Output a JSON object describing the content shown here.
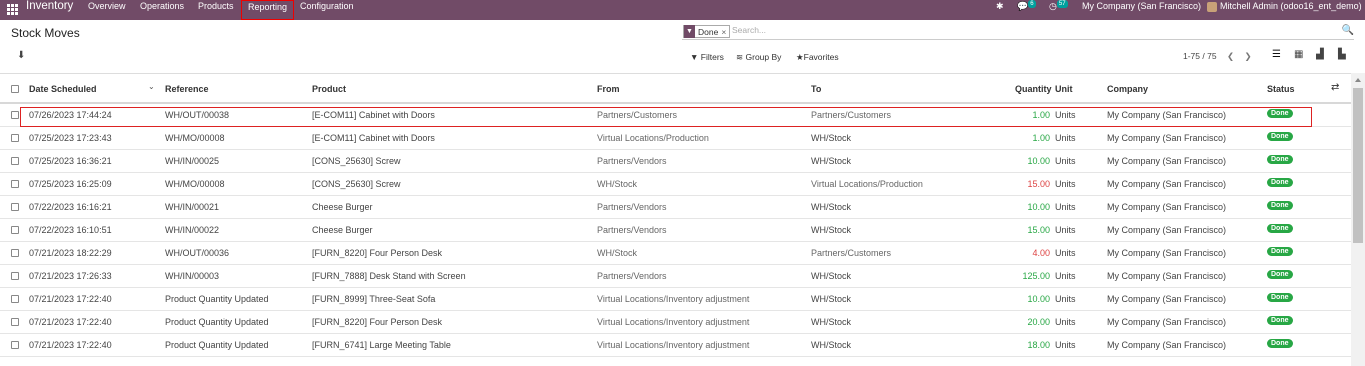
{
  "topbar": {
    "app_name": "Inventory",
    "menu": [
      "Overview",
      "Operations",
      "Products",
      "Reporting",
      "Configuration"
    ],
    "chat_count": "6",
    "activity_count": "57",
    "company": "My Company (San Francisco)",
    "user": "Mitchell Admin (odoo16_ent_demo)"
  },
  "page": {
    "title": "Stock Moves"
  },
  "search": {
    "facet_label": "Done",
    "facet_close": "×",
    "placeholder": "Search..."
  },
  "controls": {
    "filters": "Filters",
    "group_by": "Group By",
    "favorites": "Favorites"
  },
  "pager": {
    "text": "1-75 / 75"
  },
  "table": {
    "headers": [
      "Date Scheduled",
      "Reference",
      "Product",
      "From",
      "To",
      "Quantity",
      "Unit",
      "Company",
      "Status"
    ],
    "rows": [
      {
        "date": "07/26/2023 17:44:24",
        "ref": "WH/OUT/00038",
        "product": "[E-COM11] Cabinet with Doors",
        "from": "Partners/Customers",
        "to": "Partners/Customers",
        "qty": "1.00",
        "qty_color": "green",
        "unit": "Units",
        "company": "My Company (San Francisco)",
        "status": "Done"
      },
      {
        "date": "07/25/2023 17:23:43",
        "ref": "WH/MO/00008",
        "product": "[E-COM11] Cabinet with Doors",
        "from": "Virtual Locations/Production",
        "to": "WH/Stock",
        "qty": "1.00",
        "qty_color": "green",
        "unit": "Units",
        "company": "My Company (San Francisco)",
        "status": "Done"
      },
      {
        "date": "07/25/2023 16:36:21",
        "ref": "WH/IN/00025",
        "product": "[CONS_25630] Screw",
        "from": "Partners/Vendors",
        "to": "WH/Stock",
        "qty": "10.00",
        "qty_color": "green",
        "unit": "Units",
        "company": "My Company (San Francisco)",
        "status": "Done"
      },
      {
        "date": "07/25/2023 16:25:09",
        "ref": "WH/MO/00008",
        "product": "[CONS_25630] Screw",
        "from": "WH/Stock",
        "to": "Virtual Locations/Production",
        "qty": "15.00",
        "qty_color": "red",
        "unit": "Units",
        "company": "My Company (San Francisco)",
        "status": "Done"
      },
      {
        "date": "07/22/2023 16:16:21",
        "ref": "WH/IN/00021",
        "product": "Cheese Burger",
        "from": "Partners/Vendors",
        "to": "WH/Stock",
        "qty": "10.00",
        "qty_color": "green",
        "unit": "Units",
        "company": "My Company (San Francisco)",
        "status": "Done"
      },
      {
        "date": "07/22/2023 16:10:51",
        "ref": "WH/IN/00022",
        "product": "Cheese Burger",
        "from": "Partners/Vendors",
        "to": "WH/Stock",
        "qty": "15.00",
        "qty_color": "green",
        "unit": "Units",
        "company": "My Company (San Francisco)",
        "status": "Done"
      },
      {
        "date": "07/21/2023 18:22:29",
        "ref": "WH/OUT/00036",
        "product": "[FURN_8220] Four Person Desk",
        "from": "WH/Stock",
        "to": "Partners/Customers",
        "qty": "4.00",
        "qty_color": "red",
        "unit": "Units",
        "company": "My Company (San Francisco)",
        "status": "Done"
      },
      {
        "date": "07/21/2023 17:26:33",
        "ref": "WH/IN/00003",
        "product": "[FURN_7888] Desk Stand with Screen",
        "from": "Partners/Vendors",
        "to": "WH/Stock",
        "qty": "125.00",
        "qty_color": "green",
        "unit": "Units",
        "company": "My Company (San Francisco)",
        "status": "Done"
      },
      {
        "date": "07/21/2023 17:22:40",
        "ref": "Product Quantity Updated",
        "product": "[FURN_8999] Three-Seat Sofa",
        "from": "Virtual Locations/Inventory adjustment",
        "to": "WH/Stock",
        "qty": "10.00",
        "qty_color": "green",
        "unit": "Units",
        "company": "My Company (San Francisco)",
        "status": "Done"
      },
      {
        "date": "07/21/2023 17:22:40",
        "ref": "Product Quantity Updated",
        "product": "[FURN_8220] Four Person Desk",
        "from": "Virtual Locations/Inventory adjustment",
        "to": "WH/Stock",
        "qty": "20.00",
        "qty_color": "green",
        "unit": "Units",
        "company": "My Company (San Francisco)",
        "status": "Done"
      },
      {
        "date": "07/21/2023 17:22:40",
        "ref": "Product Quantity Updated",
        "product": "[FURN_6741] Large Meeting Table",
        "from": "Virtual Locations/Inventory adjustment",
        "to": "WH/Stock",
        "qty": "18.00",
        "qty_color": "green",
        "unit": "Units",
        "company": "My Company (San Francisco)",
        "status": "Done"
      }
    ]
  },
  "colors": {
    "brand": "#714B67",
    "done_badge": "#28a745",
    "qty_negative": "#dd4444",
    "qty_positive": "#28a745",
    "highlight": "#dd2222"
  }
}
